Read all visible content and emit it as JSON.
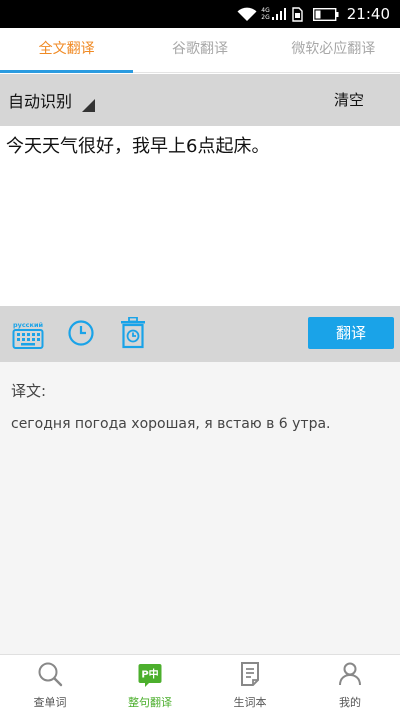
{
  "status_bar": {
    "network_top": "4G",
    "network_bottom": "2G",
    "time": "21:40"
  },
  "tabs": [
    {
      "label": "全文翻译",
      "active": true
    },
    {
      "label": "谷歌翻译",
      "active": false
    },
    {
      "label": "微软必应翻译",
      "active": false
    }
  ],
  "language_row": {
    "source_language": "自动识别",
    "clear_label": "清空"
  },
  "input": {
    "text": "今天天气很好，我早上6点起床。"
  },
  "toolbar": {
    "keyboard_label": "русский",
    "icons": [
      "keyboard-icon",
      "history-clock-icon",
      "history-delete-icon"
    ],
    "translate_label": "翻译",
    "translate_color": "#1aa3e8"
  },
  "result": {
    "label": "译文:",
    "text": "сегодня погода хорошая, я встаю в 6 утра."
  },
  "bottom_nav": [
    {
      "label": "查单词",
      "icon": "search-icon",
      "active": false
    },
    {
      "label": "整句翻译",
      "icon": "sentence-translate-icon",
      "icon_text": "P中",
      "active": true
    },
    {
      "label": "生词本",
      "icon": "notebook-icon",
      "active": false
    },
    {
      "label": "我的",
      "icon": "profile-icon",
      "active": false
    }
  ],
  "colors": {
    "active_tab_text": "#f08a24",
    "active_tab_underline": "#2a9be0",
    "active_nav": "#4caf2d",
    "toolbar_icon": "#1aa3e8"
  }
}
